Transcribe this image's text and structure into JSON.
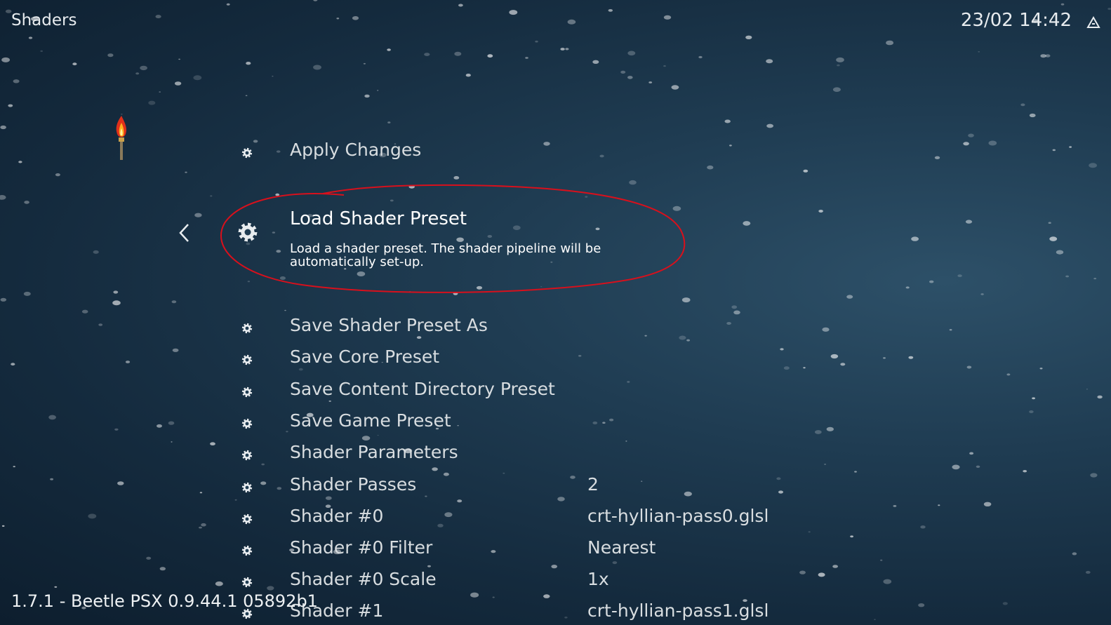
{
  "header": {
    "title": "Shaders",
    "datetime": "23/02 14:42",
    "power_icon": "power-icon"
  },
  "menu": {
    "back_icon": "chevron-left-icon",
    "items": [
      {
        "label": "Apply Changes",
        "value": ""
      },
      {
        "label": "Load Shader Preset",
        "value": "",
        "description": "Load a shader preset. The shader pipeline will be automatically set-up.",
        "selected": true
      },
      {
        "label": "Save Shader Preset As",
        "value": ""
      },
      {
        "label": "Save Core Preset",
        "value": ""
      },
      {
        "label": "Save Content Directory Preset",
        "value": ""
      },
      {
        "label": "Save Game Preset",
        "value": ""
      },
      {
        "label": "Shader Parameters",
        "value": ""
      },
      {
        "label": "Shader Passes",
        "value": "2"
      },
      {
        "label": "Shader #0",
        "value": "crt-hyllian-pass0.glsl"
      },
      {
        "label": "Shader #0 Filter",
        "value": "Nearest"
      },
      {
        "label": "Shader #0 Scale",
        "value": "1x"
      },
      {
        "label": "Shader #1",
        "value": "crt-hyllian-pass1.glsl"
      }
    ]
  },
  "footer": {
    "version": "1.7.1 - Beetle PSX 0.9.44.1 05892b1"
  },
  "colors": {
    "annotation": "#d8101c",
    "text": "#d8dde0",
    "background": "#1f3c52"
  }
}
